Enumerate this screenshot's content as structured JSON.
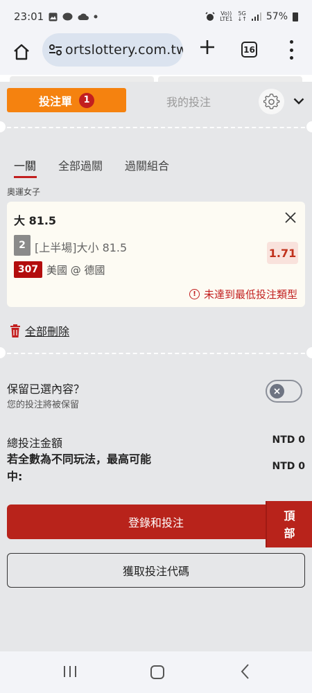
{
  "status_bar": {
    "time": "23:01",
    "network_top": "Vo))",
    "network_bottom": "LTE1",
    "signal_top": "5G",
    "signal_bottom": "↓↑",
    "battery": "57%"
  },
  "browser": {
    "url": "ortslottery.com.tw",
    "tab_count": "16"
  },
  "betslip": {
    "tab_label": "投注單",
    "badge_count": "1",
    "my_bets_label": "我的投注"
  },
  "subtabs": [
    "一關",
    "全部過關",
    "過關組合"
  ],
  "sport_label": "奧運女子",
  "bet": {
    "selection": "大 81.5",
    "period_number": "2",
    "market": "[上半場]大小 81.5",
    "match_number": "307",
    "teams": "美國 @ 德國",
    "odds": "1.71",
    "warning": "未達到最低投注類型"
  },
  "delete_all_label": "全部刪除",
  "keep_selection": {
    "title": "保留已選內容？",
    "subtitle": "您的投注將被保留"
  },
  "summary": {
    "total_label": "總投注金額",
    "total_value": "NTD 0",
    "potential_label": "若全數為不同玩法，最高可能中:",
    "potential_value": "NTD 0"
  },
  "actions": {
    "register_label": "登錄和投注",
    "top_label_1": "頂",
    "top_label_2": "部",
    "code_label": "獲取投注代碼"
  }
}
